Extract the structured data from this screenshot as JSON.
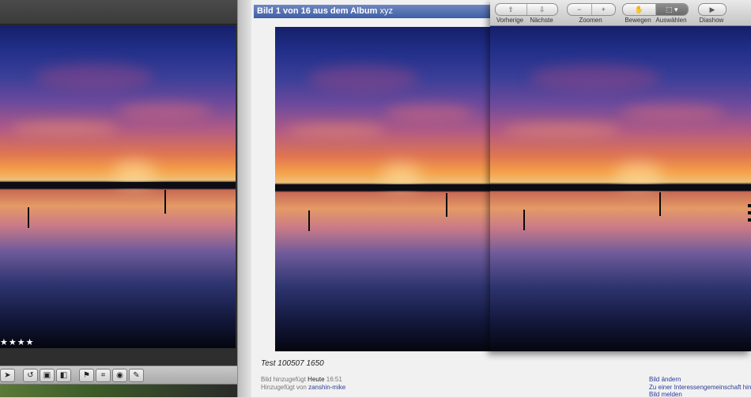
{
  "left_window": {
    "rating_stars": "★★★★",
    "toolbar_icons": [
      "pointer-tool-icon",
      "rotate-left-icon",
      "stack-icon",
      "compare-icon",
      "flag-icon",
      "crop-icon",
      "eye-icon",
      "brush-icon"
    ]
  },
  "album": {
    "header_prefix": "Bild 1 von 16 aus dem Album",
    "album_name": "xyz",
    "caption": "Test 100507 1650",
    "added_label": "Bild hinzugefügt",
    "added_value": "Heute",
    "added_time": "16:51",
    "added_by_label": "Hinzugefügt von",
    "added_by_user": "zanshin-mike",
    "links": {
      "edit": "Bild ändern",
      "community": "Zu einer Interessengemeinschaft hin",
      "report": "Bild melden"
    }
  },
  "viewer": {
    "toolbar": {
      "prev_label": "Vorherige",
      "next_label": "Nächste",
      "zoom_label": "Zoomen",
      "zoom_out_symbol": "−",
      "zoom_in_symbol": "+",
      "move_label": "Bewegen",
      "select_label": "Auswählen",
      "slideshow_label": "Diashow"
    }
  }
}
